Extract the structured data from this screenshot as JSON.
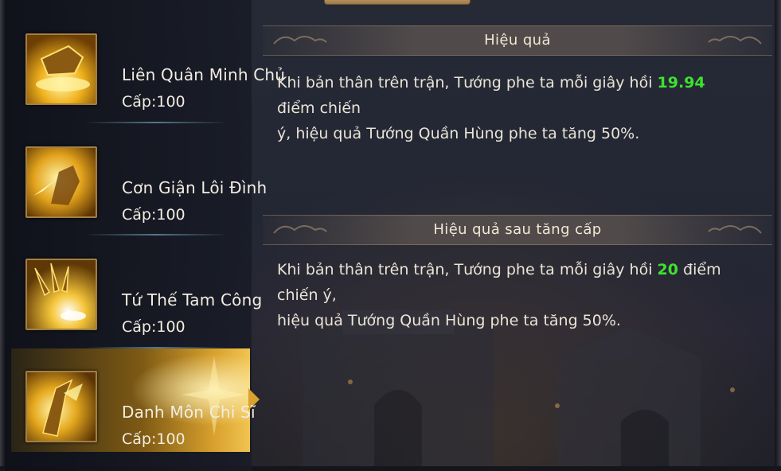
{
  "skills": [
    {
      "name": "Liên Quân Minh Chủ",
      "level": "Cấp:100",
      "icon": "golden-shield-icon"
    },
    {
      "name": "Cơn Giận Lôi Đình",
      "level": "Cấp:100",
      "icon": "warrior-strike-icon"
    },
    {
      "name": "Tứ Thế Tam Công",
      "level": "Cấp:100",
      "icon": "claws-burst-icon"
    },
    {
      "name": "Danh Môn Chi Sĩ",
      "level": "Cấp:100",
      "icon": "golden-blade-icon",
      "selected": true
    }
  ],
  "effect": {
    "title": "Hiệu quả",
    "text_before": "Khi bản thân trên trận, Tướng phe ta mỗi giây hồi ",
    "value": "19.94",
    "text_mid": " điểm chiến",
    "text_after": "ý, hiệu quả Tướng Quần Hùng phe ta tăng 50%."
  },
  "upgrade_effect": {
    "title": "Hiệu quả sau tăng cấp",
    "text_before": "Khi bản thân trên trận, Tướng phe ta mỗi giây hồi ",
    "value": "20",
    "text_mid": " điểm chiến ý,",
    "text_after": "hiệu quả Tướng Quần Hùng phe ta tăng 50%."
  },
  "colors": {
    "highlight": "#3fe12f",
    "gold": "#d9a12d",
    "panel": "#232734"
  }
}
